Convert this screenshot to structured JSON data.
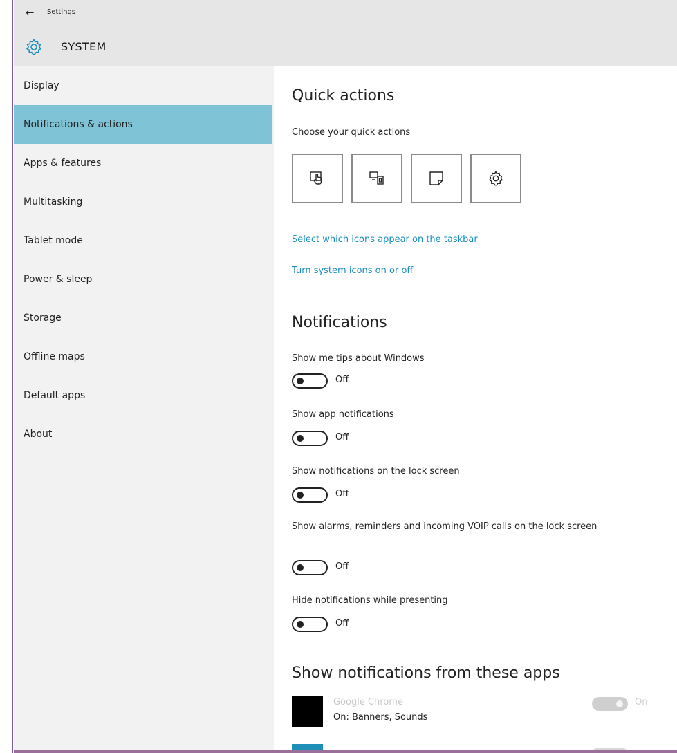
{
  "window": {
    "title": "Settings",
    "back_icon": "back-arrow-icon"
  },
  "header": {
    "icon": "gear-icon",
    "title": "SYSTEM"
  },
  "sidebar": {
    "selected": "Notifications & actions",
    "selected_color": "#7fc4d6",
    "items": [
      {
        "label": "Display"
      },
      {
        "label": "Notifications & actions"
      },
      {
        "label": "Apps & features"
      },
      {
        "label": "Multitasking"
      },
      {
        "label": "Tablet mode"
      },
      {
        "label": "Power & sleep"
      },
      {
        "label": "Storage"
      },
      {
        "label": "Offline maps"
      },
      {
        "label": "Default apps"
      },
      {
        "label": "About"
      }
    ]
  },
  "quick_actions": {
    "heading": "Quick actions",
    "subheading": "Choose your quick actions",
    "tiles": [
      {
        "icon": "tablet-mode-icon"
      },
      {
        "icon": "connect-icon"
      },
      {
        "icon": "note-icon"
      },
      {
        "icon": "settings-gear-icon"
      }
    ],
    "links": [
      "Select which icons appear on the taskbar",
      "Turn system icons on or off"
    ],
    "link_color": "#1a8fbf"
  },
  "notifications": {
    "heading": "Notifications",
    "settings": [
      {
        "label": "Show me tips about Windows",
        "state": "Off"
      },
      {
        "label": "Show app notifications",
        "state": "Off"
      },
      {
        "label": "Show notifications on the lock screen",
        "state": "Off"
      },
      {
        "label": "Show alarms, reminders and incoming VOIP calls on the lock screen",
        "state": "Off"
      },
      {
        "label": "Hide notifications while presenting",
        "state": "Off"
      }
    ]
  },
  "apps": {
    "heading": "Show notifications from these apps",
    "items": [
      {
        "name": "Google Chrome",
        "detail": "On: Banners, Sounds",
        "state": "On"
      }
    ]
  }
}
